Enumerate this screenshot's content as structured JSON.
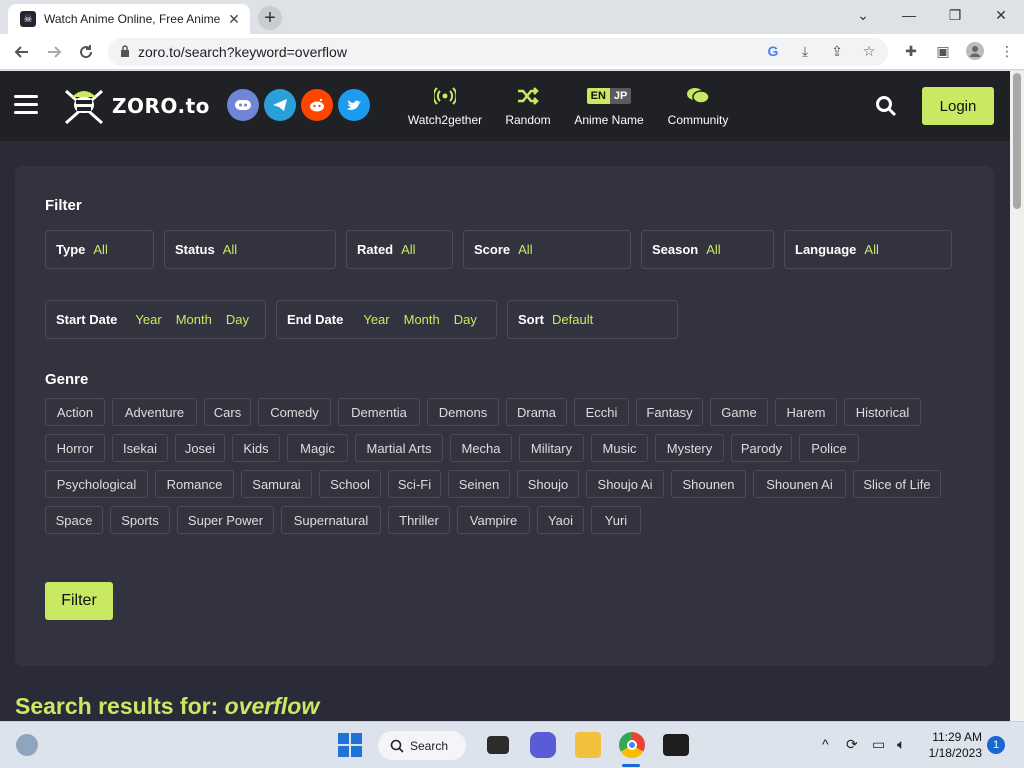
{
  "browser": {
    "tab_title": "Watch Anime Online, Free Anime",
    "tab_close": "✕",
    "new_tab": "+",
    "url": "zoro.to/search?keyword=overflow",
    "window_controls": [
      "⌄",
      "—",
      "❐",
      "✕"
    ]
  },
  "header": {
    "logo_text": "ZORO.to",
    "nav": [
      {
        "label": "Watch2gether",
        "icon": "broadcast-icon"
      },
      {
        "label": "Random",
        "icon": "shuffle-icon"
      },
      {
        "label": "Anime Name",
        "icon": "lang-toggle"
      },
      {
        "label": "Community",
        "icon": "chat-icon"
      }
    ],
    "lang_en": "EN",
    "lang_jp": "JP",
    "login": "Login",
    "social": [
      {
        "name": "discord-icon",
        "color": "#6f85d5"
      },
      {
        "name": "telegram-icon",
        "color": "#2aa0d8"
      },
      {
        "name": "reddit-icon",
        "color": "#ff4500"
      },
      {
        "name": "twitter-icon",
        "color": "#1d9bf0"
      }
    ]
  },
  "filter": {
    "title": "Filter",
    "fields": [
      {
        "label": "Type",
        "value": "All"
      },
      {
        "label": "Status",
        "value": "All"
      },
      {
        "label": "Rated",
        "value": "All"
      },
      {
        "label": "Score",
        "value": "All"
      },
      {
        "label": "Season",
        "value": "All"
      },
      {
        "label": "Language",
        "value": "All"
      }
    ],
    "start_date": {
      "label": "Start Date",
      "year": "Year",
      "month": "Month",
      "day": "Day"
    },
    "end_date": {
      "label": "End Date",
      "year": "Year",
      "month": "Month",
      "day": "Day"
    },
    "sort": {
      "label": "Sort",
      "value": "Default"
    },
    "genre_title": "Genre",
    "genres": [
      [
        "Action",
        "Adventure",
        "Cars",
        "Comedy",
        "Dementia",
        "Demons",
        "Drama",
        "Ecchi",
        "Fantasy",
        "Game",
        "Harem",
        "Historical"
      ],
      [
        "Horror",
        "Isekai",
        "Josei",
        "Kids",
        "Magic",
        "Martial Arts",
        "Mecha",
        "Military",
        "Music",
        "Mystery",
        "Parody",
        "Police"
      ],
      [
        "Psychological",
        "Romance",
        "Samurai",
        "School",
        "Sci-Fi",
        "Seinen",
        "Shoujo",
        "Shoujo Ai",
        "Shounen",
        "Shounen Ai",
        "Slice of Life"
      ],
      [
        "Space",
        "Sports",
        "Super Power",
        "Supernatural",
        "Thriller",
        "Vampire",
        "Yaoi",
        "Yuri"
      ]
    ],
    "button": "Filter"
  },
  "results": {
    "prefix": "Search results for: ",
    "keyword": "overflow"
  },
  "taskbar": {
    "search_label": "Search",
    "time": "11:29 AM",
    "date": "1/18/2023",
    "notifications": "1"
  },
  "colors": {
    "accent": "#cae962",
    "page_bg": "#2a2a38",
    "panel_bg": "#33333f"
  }
}
